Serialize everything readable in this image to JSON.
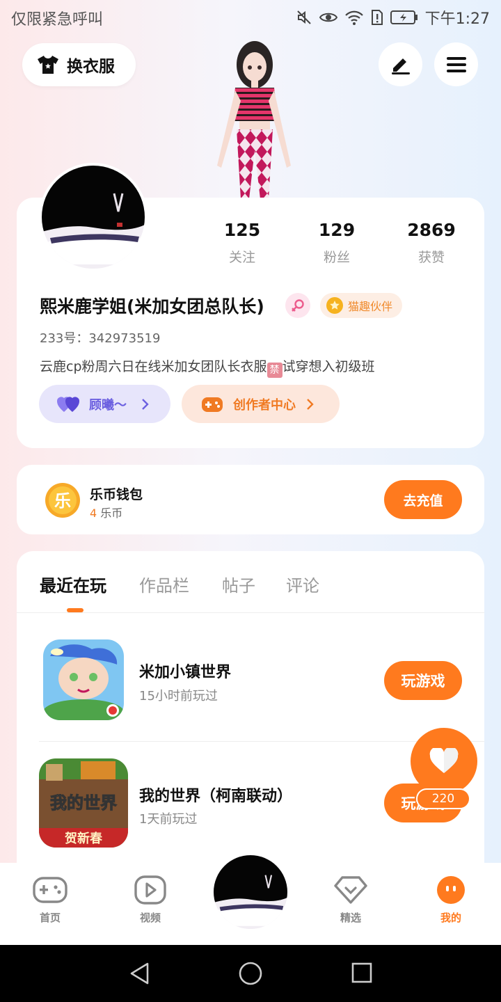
{
  "status_bar": {
    "left_text": "仅限紧急呼叫",
    "time": "下午1:27"
  },
  "header": {
    "wardrobe_label": "换衣服"
  },
  "profile": {
    "stats": [
      {
        "value": "125",
        "label": "关注"
      },
      {
        "value": "129",
        "label": "粉丝"
      },
      {
        "value": "2869",
        "label": "获赞"
      }
    ],
    "nickname": "熙米鹿学姐(米加女团总队长)",
    "partner_badge": "猫趣伙伴",
    "id_line": "233号：342973519",
    "bio_before": "云鹿cp粉周六日在线米加女团队长衣服",
    "bio_ban": "禁",
    "bio_after": "试穿想入初级班",
    "guxi_label": "顾曦～",
    "creator_label": "创作者中心"
  },
  "wallet": {
    "title": "乐币钱包",
    "amount": "4",
    "unit": "乐币",
    "recharge_label": "去充值",
    "coin_glyph": "乐"
  },
  "tabs": [
    {
      "label": "最近在玩",
      "active": true
    },
    {
      "label": "作品栏"
    },
    {
      "label": "帖子"
    },
    {
      "label": "评论"
    }
  ],
  "games": [
    {
      "title": "米加小镇世界",
      "last_played": "15小时前玩过",
      "button": "玩游戏"
    },
    {
      "title": "我的世界（柯南联动）",
      "last_played": "1天前玩过",
      "button": "玩游戏",
      "icon_text_top": "我的世界",
      "icon_text_bottom": "贺新春"
    }
  ],
  "like_fab": {
    "count": "220"
  },
  "bottom_nav": [
    {
      "label": "首页"
    },
    {
      "label": "视频"
    },
    {
      "label": "精选"
    },
    {
      "label": "我的",
      "active": true
    }
  ],
  "colors": {
    "accent": "#ff7a1e",
    "purple": "#6b5fe0"
  }
}
